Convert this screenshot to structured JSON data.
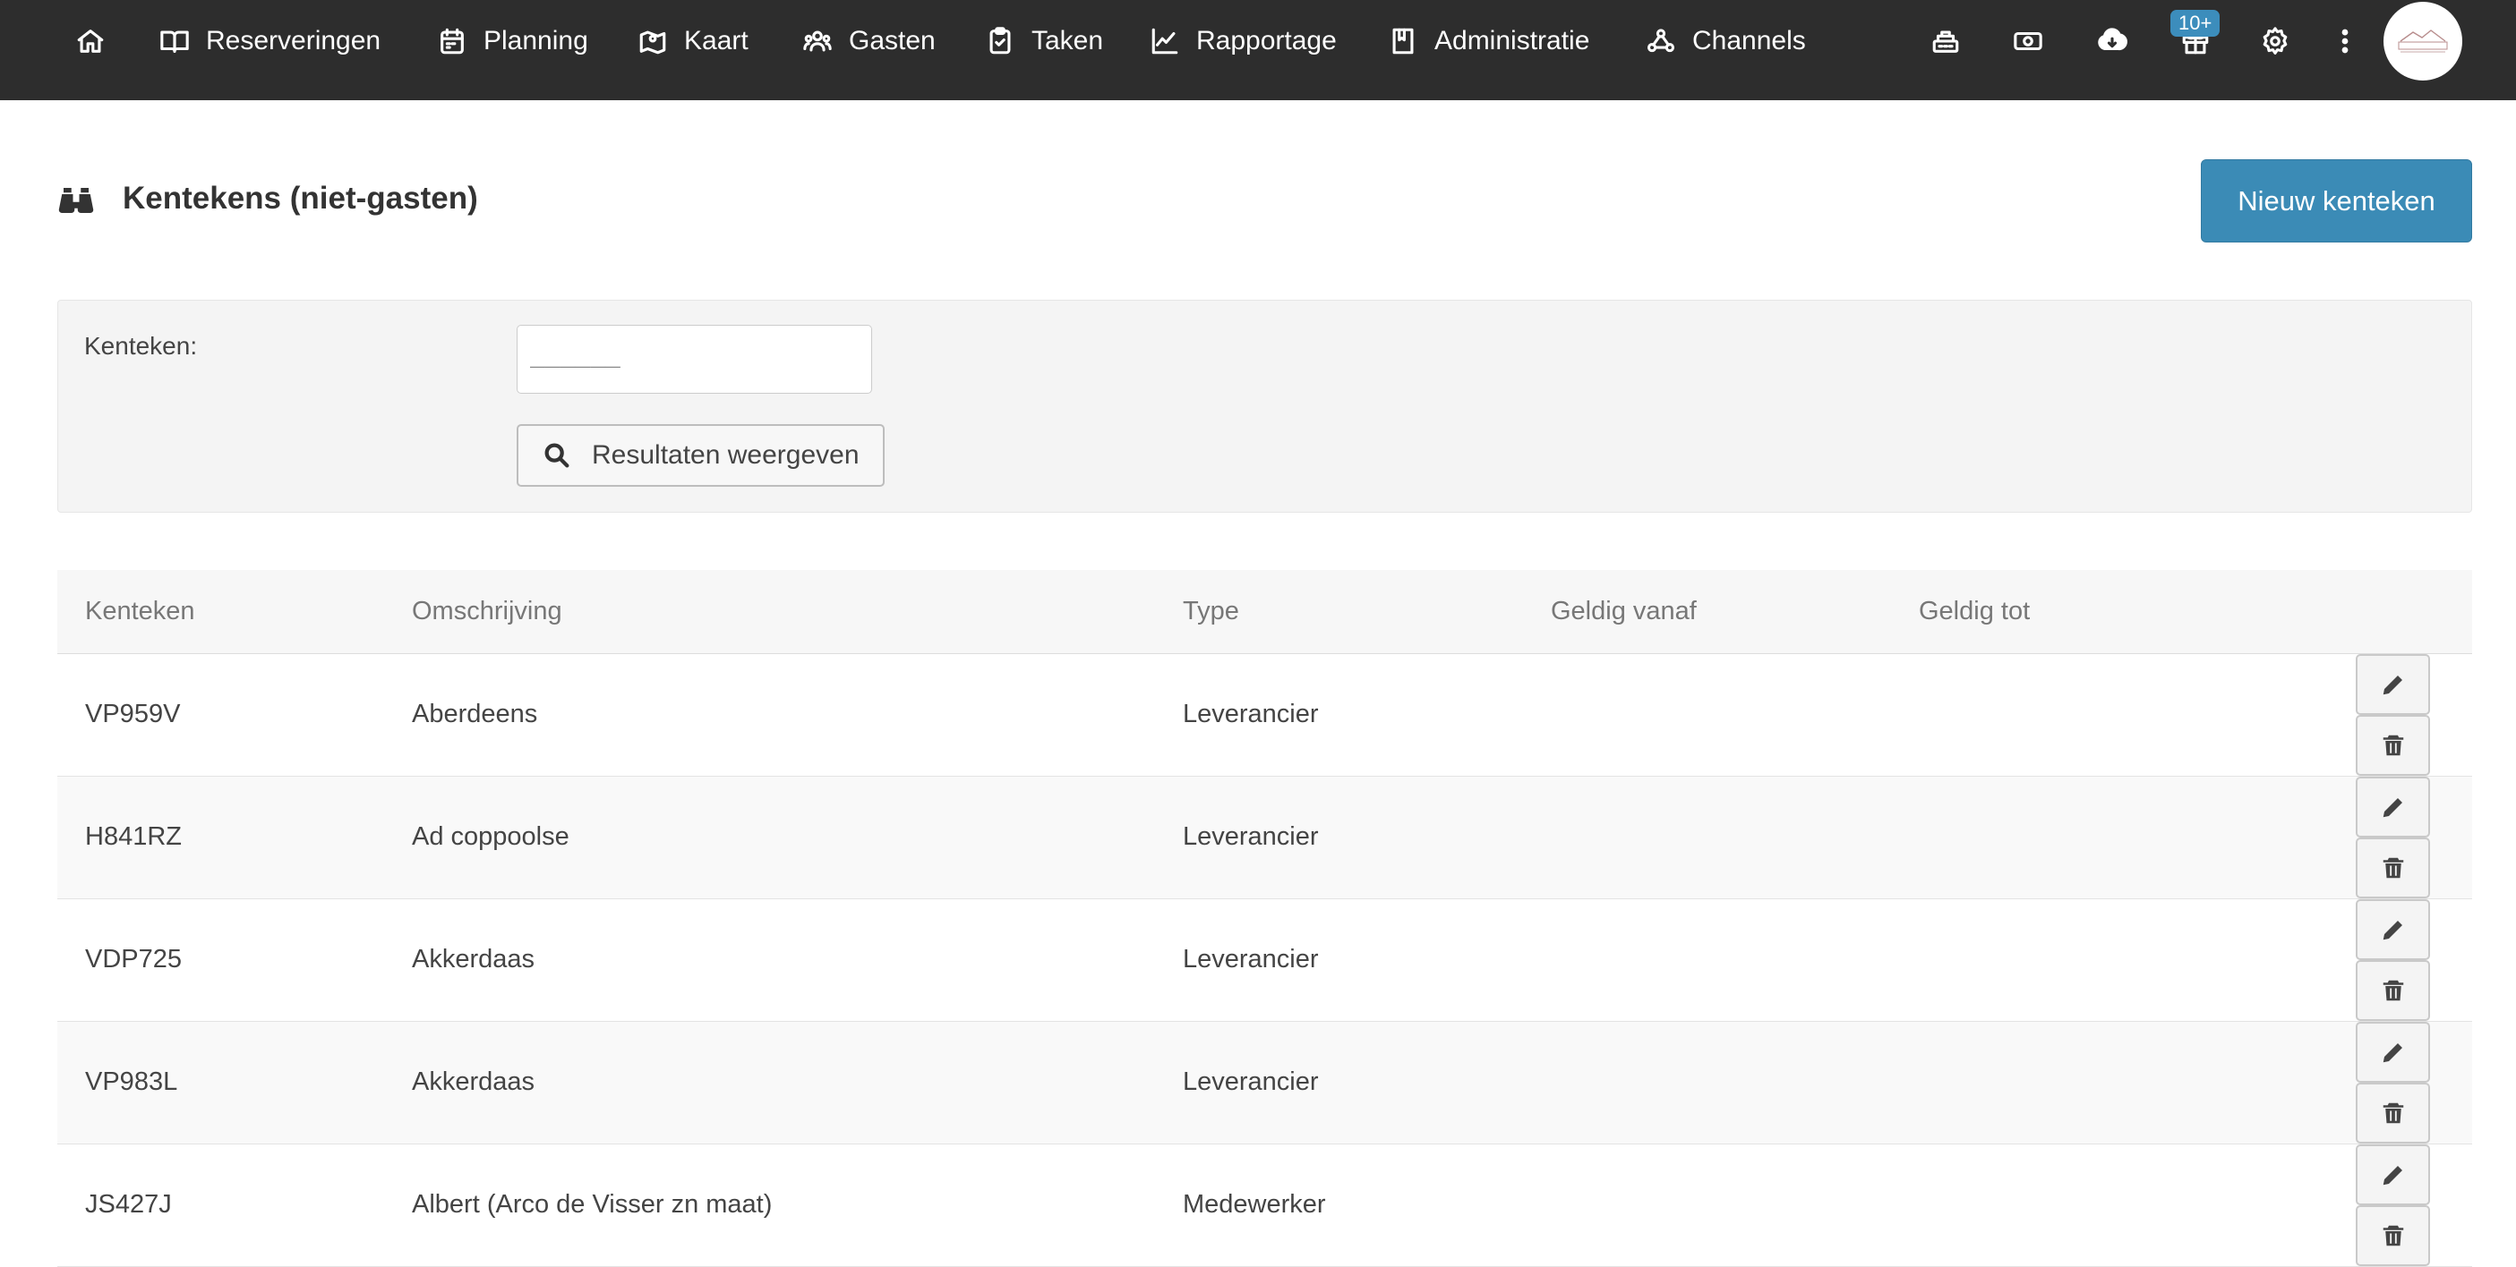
{
  "nav": {
    "home_icon": "home-icon",
    "items": [
      {
        "label": "Reserveringen",
        "icon": "book-open-icon"
      },
      {
        "label": "Planning",
        "icon": "calendar-icon"
      },
      {
        "label": "Kaart",
        "icon": "map-pin-icon"
      },
      {
        "label": "Gasten",
        "icon": "users-icon"
      },
      {
        "label": "Taken",
        "icon": "clipboard-check-icon"
      },
      {
        "label": "Rapportage",
        "icon": "line-chart-icon"
      },
      {
        "label": "Administratie",
        "icon": "ledger-book-icon"
      },
      {
        "label": "Channels",
        "icon": "webhook-icon"
      }
    ],
    "right_icons": [
      "cash-register-icon",
      "money-icon",
      "cloud-download-icon",
      "gift-icon",
      "gear-icon",
      "more-vertical-icon"
    ],
    "notification_badge": "10+",
    "avatar_icon": "company-logo-avatar"
  },
  "header": {
    "icon": "binoculars-icon",
    "title": "Kentekens (niet-gasten)",
    "new_button": "Nieuw kenteken"
  },
  "filter": {
    "label": "Kenteken:",
    "input_value": "______",
    "search_button": "Resultaten weergeven",
    "search_icon": "search-icon"
  },
  "table": {
    "columns": [
      "Kenteken",
      "Omschrijving",
      "Type",
      "Geldig vanaf",
      "Geldig tot",
      ""
    ],
    "rows": [
      {
        "kenteken": "VP959V",
        "omschrijving": "Aberdeens",
        "type": "Leverancier",
        "geldig_vanaf": "",
        "geldig_tot": ""
      },
      {
        "kenteken": "H841RZ",
        "omschrijving": "Ad coppoolse",
        "type": "Leverancier",
        "geldig_vanaf": "",
        "geldig_tot": ""
      },
      {
        "kenteken": "VDP725",
        "omschrijving": "Akkerdaas",
        "type": "Leverancier",
        "geldig_vanaf": "",
        "geldig_tot": ""
      },
      {
        "kenteken": "VP983L",
        "omschrijving": "Akkerdaas",
        "type": "Leverancier",
        "geldig_vanaf": "",
        "geldig_tot": ""
      },
      {
        "kenteken": "JS427J",
        "omschrijving": "Albert (Arco de Visser zn maat)",
        "type": "Medewerker",
        "geldig_vanaf": "",
        "geldig_tot": ""
      }
    ],
    "edit_icon": "pencil-icon",
    "delete_icon": "trash-icon"
  },
  "colors": {
    "topbar": "#2d2d2d",
    "primary": "#3b8bb6",
    "badge": "#3c8dbc"
  }
}
